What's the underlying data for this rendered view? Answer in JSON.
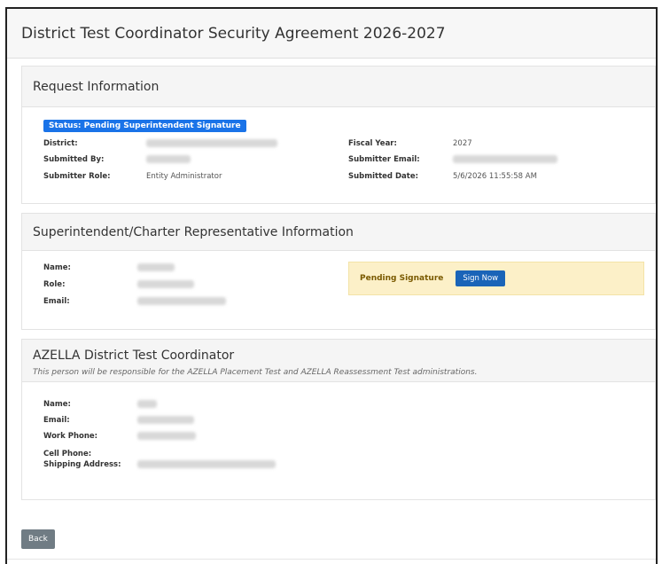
{
  "page": {
    "title": "District Test Coordinator Security Agreement 2026-2027"
  },
  "request_info": {
    "heading": "Request Information",
    "status": "Status: Pending Superintendent Signature",
    "district_label": "District:",
    "submitted_by_label": "Submitted By:",
    "submitter_role_label": "Submitter Role:",
    "submitter_role_value": "Entity Administrator",
    "fiscal_year_label": "Fiscal Year:",
    "fiscal_year_value": "2027",
    "submitter_email_label": "Submitter Email:",
    "submitted_date_label": "Submitted Date:",
    "submitted_date_value": "5/6/2026 11:55:58 AM"
  },
  "superintendent": {
    "heading": "Superintendent/Charter Representative Information",
    "name_label": "Name:",
    "role_label": "Role:",
    "email_label": "Email:",
    "pending_text": "Pending Signature",
    "sign_now_label": "Sign Now"
  },
  "azella": {
    "heading": "AZELLA District Test Coordinator",
    "subheading": "This person will be responsible for the AZELLA Placement Test and AZELLA Reassessment Test administrations.",
    "name_label": "Name:",
    "email_label": "Email:",
    "work_phone_label": "Work Phone:",
    "cell_phone_label": "Cell Phone:",
    "shipping_address_label": "Shipping Address:"
  },
  "footer": {
    "back_label": "Back"
  },
  "colors": {
    "status_badge": "#1a73e8",
    "sign_button": "#1a64b8",
    "pending_background": "#fcf0c8",
    "back_button": "#707c84"
  }
}
